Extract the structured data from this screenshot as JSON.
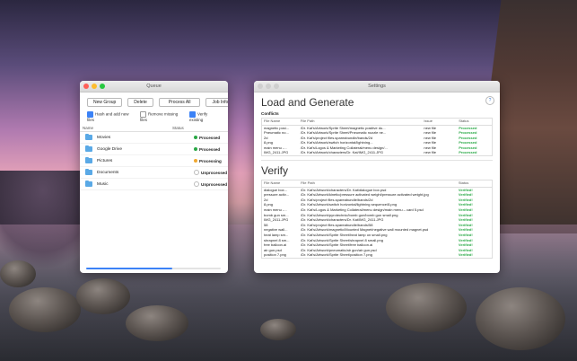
{
  "queue_window": {
    "title": "Queue",
    "toolbar": {
      "new_group": "New Group",
      "delete": "Delete",
      "process_all": "Process All",
      "job_info": "Job Info",
      "help": "?"
    },
    "options": [
      {
        "label": "Hash and add new files",
        "checked": true
      },
      {
        "label": "Remove missing files",
        "checked": false
      },
      {
        "label": "Verify existing",
        "checked": true
      }
    ],
    "columns": {
      "name": "Name",
      "status": "Status"
    },
    "rows": [
      {
        "name": "Movies",
        "status": "Processed",
        "color": "#28a745"
      },
      {
        "name": "Google Drive",
        "status": "Processed",
        "color": "#28a745"
      },
      {
        "name": "Pictures",
        "status": "Processing",
        "color": "#f0a830"
      },
      {
        "name": "Documents",
        "status": "Unprocessed",
        "color": "#cfcfcf"
      },
      {
        "name": "Music",
        "status": "Unprocessed",
        "color": "#cfcfcf"
      }
    ],
    "progress": 0.64
  },
  "settings_window": {
    "title": "Settings",
    "help": "?",
    "load_section": {
      "heading": "Load and Generate",
      "subheading": "Conflicts",
      "columns": {
        "file_name": "File Name",
        "file_path": "File Path",
        "issue": "Issue",
        "status": "Status"
      },
      "rows": [
        {
          "file_name": "magnetic posi...",
          "file_path": "/Dr. Kat's/Artwork/Sprite Sheet/magnetic positive du...",
          "issue": "new file",
          "status": "Processed"
        },
        {
          "file_name": "Pneumatic no...",
          "file_path": "/Dr. Kat's/Artwork/Sprite Sheet/Pneumatic nozzle ne...",
          "issue": "new file",
          "status": "Processed"
        },
        {
          "file_name": "2d",
          "file_path": "/Dr. Kat's/project files.spareabundle/bands/2d",
          "issue": "new file",
          "status": "Processed"
        },
        {
          "file_name": "8.png",
          "file_path": "/Dr. Kat's/Artwork/switch horizontal/lightning...",
          "issue": "new file",
          "status": "Processed"
        },
        {
          "file_name": "main menu -...",
          "file_path": "/Dr. Kat's/Logos & Marketing Collateral/menu design/...",
          "issue": "new file",
          "status": "Processed"
        },
        {
          "file_name": "IMG_2411.JPG",
          "file_path": "/Dr. Kat's/Artwork/characters/Dr. Kat/IMG_2411.JPG",
          "issue": "new file",
          "status": "Processed"
        }
      ]
    },
    "verify_section": {
      "heading": "Verify",
      "columns": {
        "file_name": "File Name",
        "file_path": "File Path",
        "status": "Status"
      },
      "rows": [
        {
          "file_name": "dialogue box...",
          "file_path": "/Dr. Kat's/Artwork/characters/Dr. Kat/dialogue box.psd",
          "status": "Verified!"
        },
        {
          "file_name": "pressure activ...",
          "file_path": "/Dr. Kat's/Artwork/kinetic/pressure activated weight/pressure activated weight.jpg",
          "status": "Verified!"
        },
        {
          "file_name": "2d",
          "file_path": "/Dr. Kat's/project files.spareabundle/bands/2d",
          "status": "Verified!"
        },
        {
          "file_name": "8.png",
          "file_path": "/Dr. Kat's/Artwork/switch horizontal/lightning sequence/8.png",
          "status": "Verified!"
        },
        {
          "file_name": "main menu -...",
          "file_path": "/Dr. Kat's/Logos & Marketing Collateral/menu design/main menu – card 5.psd",
          "status": "Verified!"
        },
        {
          "file_name": "bomb gun sm...",
          "file_path": "/Dr. Kat's/Artwork/pyrotechnic/bomb gun/bomb gun small.png",
          "status": "Verified!"
        },
        {
          "file_name": "IMG_2411.JPG",
          "file_path": "/Dr. Kat's/Artwork/characters/Dr. Kat/IMG_2411.JPG",
          "status": "Verified!"
        },
        {
          "file_name": "58",
          "file_path": "/Dr. Kat's/project files.spareabundle/bands/58",
          "status": "Verified!"
        },
        {
          "file_name": "negative wall...",
          "file_path": "/Dr. Kat's/Artwork/magnetic/Mounted Magnet/negative wall mounted magnet.psd",
          "status": "Verified!"
        },
        {
          "file_name": "heat lamp sm...",
          "file_path": "/Dr. Kat's/Artwork/Sprite Sheet/heat lamp on small.png",
          "status": "Verified!"
        },
        {
          "file_name": "shrapnel 8 sm...",
          "file_path": "/Dr. Kat's/Artwork/Sprite Sheet/shrapnel 8 small.png",
          "status": "Verified!"
        },
        {
          "file_name": "free balloon.ai",
          "file_path": "/Dr. Kat's/Artwork/Sprite Sheet/free balloon.ai",
          "status": "Verified!"
        },
        {
          "file_name": "air gun.psd",
          "file_path": "/Dr. Kat's/Artwork/pneumatic/air gun/air gun.psd",
          "status": "Verified!"
        },
        {
          "file_name": "position 7.png",
          "file_path": "/Dr. Kat's/Artwork/Sprite Sheet/position 7.png",
          "status": "Verified!"
        }
      ]
    }
  }
}
